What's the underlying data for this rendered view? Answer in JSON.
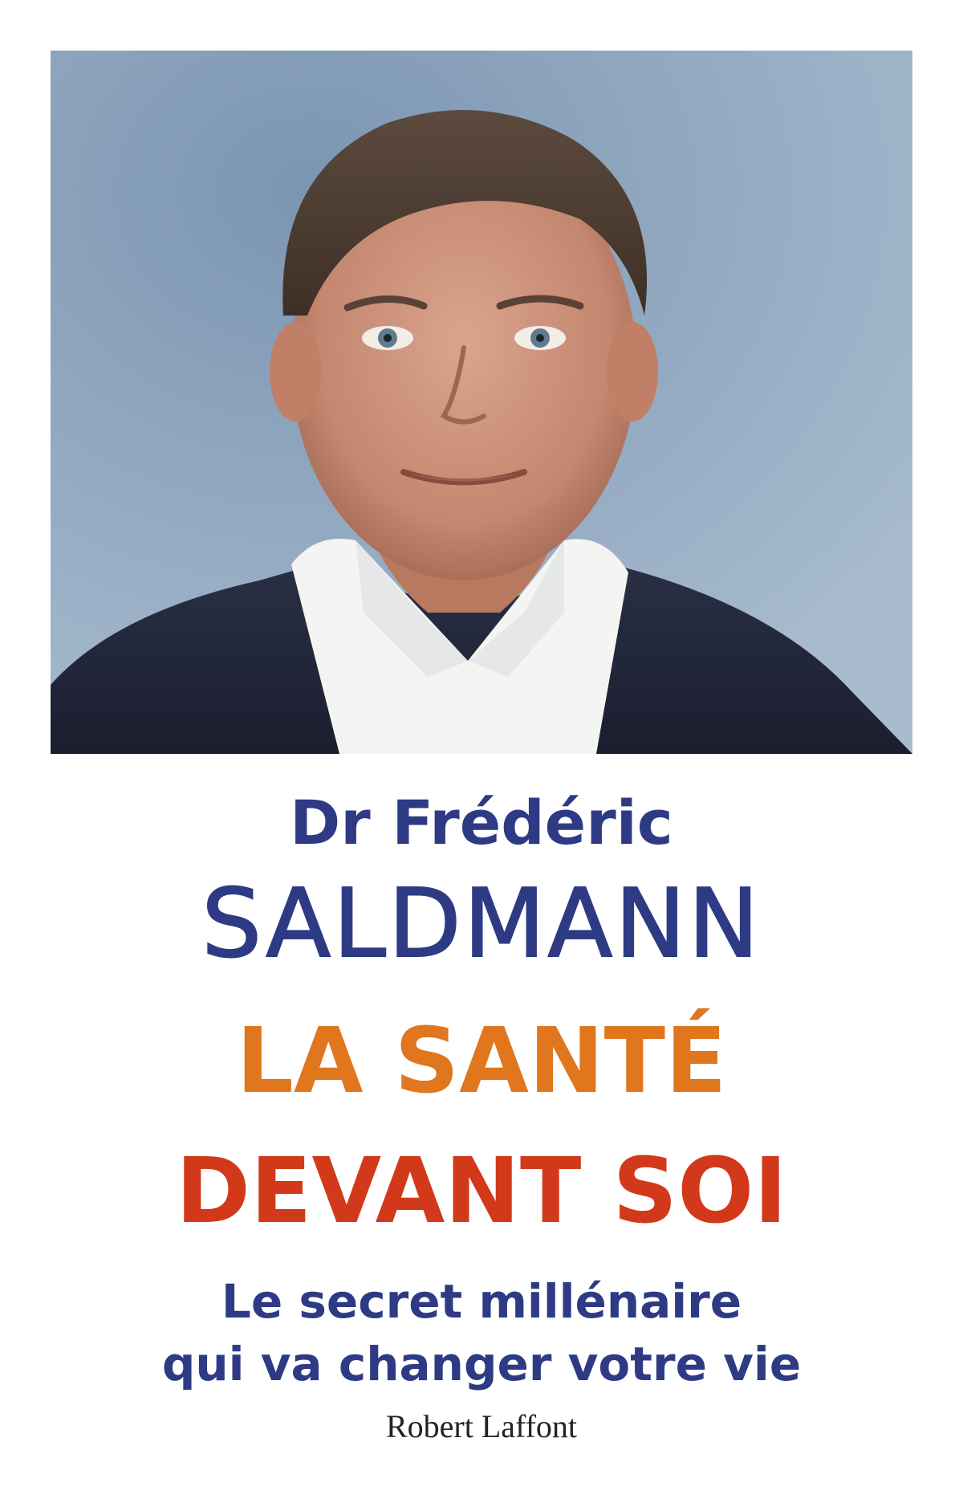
{
  "cover": {
    "author_first": "Dr Frédéric",
    "author_last": "SALDMANN",
    "title_line_1": "LA SANTÉ",
    "title_line_2": "DEVANT SOI",
    "subtitle_line_1": "Le secret millénaire",
    "subtitle_line_2": "qui va changer votre vie",
    "publisher": "Robert Laffont"
  },
  "colors": {
    "background": "#ffffff",
    "author_blue": "#2e3b84",
    "title_orange": "#e0761d",
    "title_red": "#d2391a",
    "photo_backdrop": "#8aa3be"
  }
}
